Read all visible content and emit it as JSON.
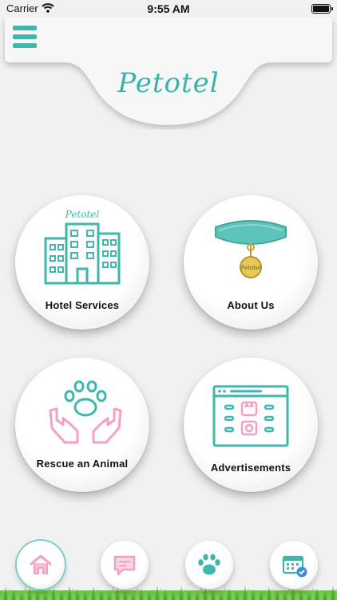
{
  "status_bar": {
    "carrier": "Carrier",
    "time": "9:55 AM"
  },
  "header": {
    "app_name": "Petotel",
    "menu_icon": "hamburger-menu-icon"
  },
  "tiles": [
    {
      "label": "Hotel Services",
      "icon": "hotel-building-icon",
      "logo_text": "Petotel"
    },
    {
      "label": "About Us",
      "icon": "pet-collar-icon",
      "logo_text": "Petotel"
    },
    {
      "label": "Rescue an Animal",
      "icon": "hands-paw-icon"
    },
    {
      "label": "Advertisements",
      "icon": "browser-ads-icon"
    }
  ],
  "bottom_nav": [
    {
      "name": "home",
      "icon": "home-icon",
      "active": true
    },
    {
      "name": "messages",
      "icon": "chat-icon"
    },
    {
      "name": "pets",
      "icon": "paw-icon"
    },
    {
      "name": "bookings",
      "icon": "calendar-check-icon"
    }
  ],
  "colors": {
    "accent_teal": "#3fb7ad",
    "accent_pink": "#f2a0c5",
    "background": "#f1f1f1"
  }
}
